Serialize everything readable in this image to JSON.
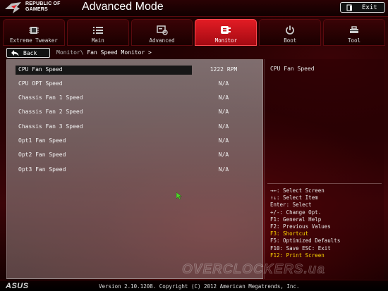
{
  "header": {
    "brand_line1": "REPUBLIC OF",
    "brand_line2": "GAMERS",
    "mode_title": "Advanced Mode",
    "exit_label": "Exit"
  },
  "tabs": [
    {
      "label": "Extreme Tweaker",
      "icon": "cpu-chip-icon",
      "active": false
    },
    {
      "label": "Main",
      "icon": "list-icon",
      "active": false
    },
    {
      "label": "Advanced",
      "icon": "advanced-icon",
      "active": false
    },
    {
      "label": "Monitor",
      "icon": "monitor-icon",
      "active": true
    },
    {
      "label": "Boot",
      "icon": "power-icon",
      "active": false
    },
    {
      "label": "Tool",
      "icon": "tool-icon",
      "active": false
    }
  ],
  "nav": {
    "back_label": "Back",
    "breadcrumb_parent": "Monitor\\",
    "breadcrumb_current": "Fan Speed Monitor >"
  },
  "fan_list": [
    {
      "label": "CPU Fan Speed",
      "value": "1222 RPM",
      "selected": true
    },
    {
      "label": "CPU OPT Speed",
      "value": "N/A",
      "selected": false
    },
    {
      "label": "Chassis Fan 1 Speed",
      "value": "N/A",
      "selected": false
    },
    {
      "label": "Chassis Fan 2 Speed",
      "value": "N/A",
      "selected": false
    },
    {
      "label": "Chassis Fan 3 Speed",
      "value": "N/A",
      "selected": false
    },
    {
      "label": "Opt1 Fan Speed",
      "value": "N/A",
      "selected": false
    },
    {
      "label": "Opt2 Fan Speed",
      "value": "N/A",
      "selected": false
    },
    {
      "label": "Opt3 Fan Speed",
      "value": "N/A",
      "selected": false
    }
  ],
  "help": {
    "title": "CPU Fan Speed"
  },
  "key_help": [
    {
      "text": "→←: Select Screen",
      "highlight": false
    },
    {
      "text": "↑↓: Select Item",
      "highlight": false
    },
    {
      "text": "Enter: Select",
      "highlight": false
    },
    {
      "text": "+/-: Change Opt.",
      "highlight": false
    },
    {
      "text": "F1: General Help",
      "highlight": false
    },
    {
      "text": "F2: Previous Values",
      "highlight": false
    },
    {
      "text": "F3: Shortcut",
      "highlight": true
    },
    {
      "text": "F5: Optimized Defaults",
      "highlight": false
    },
    {
      "text": "F10: Save  ESC: Exit",
      "highlight": false
    },
    {
      "text": "F12: Print Screen",
      "highlight": true
    }
  ],
  "footer": {
    "brand": "ASUS",
    "version_text": "Version 2.10.1208. Copyright (C) 2012 American Megatrends, Inc."
  },
  "watermark": "OVERCLOCKERS.ua",
  "colors": {
    "accent_red": "#e21c24",
    "highlight_yellow": "#ffd700",
    "panel_gray": "#8f8585"
  }
}
